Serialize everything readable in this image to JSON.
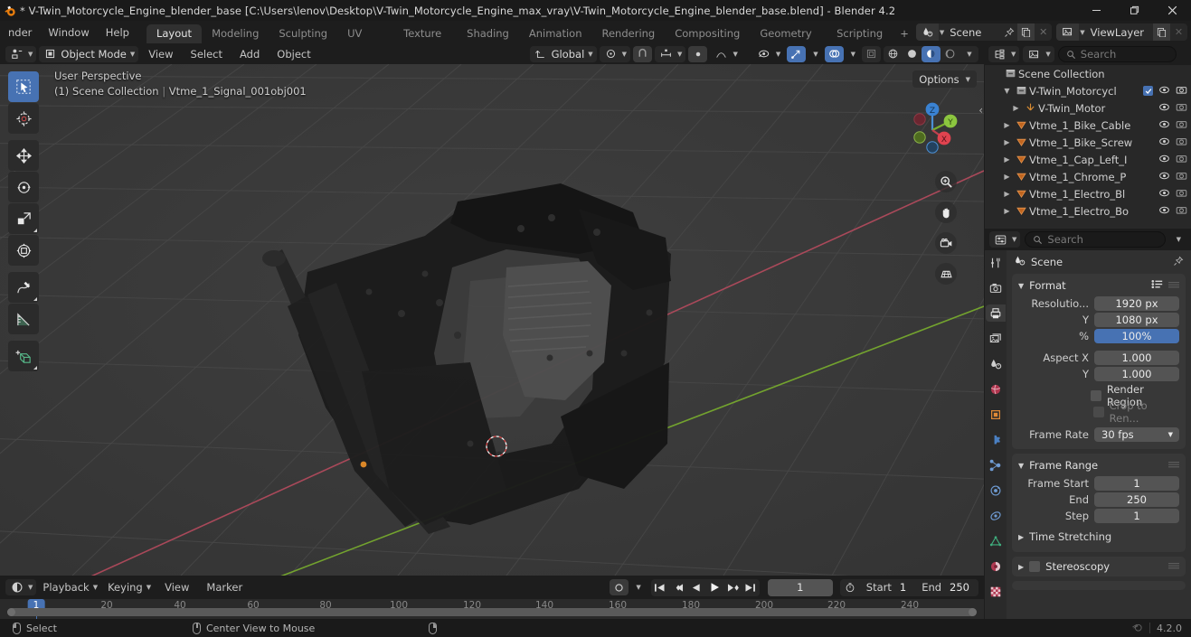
{
  "titlebar": {
    "title": "* V-Twin_Motorcycle_Engine_blender_base [C:\\Users\\lenov\\Desktop\\V-Twin_Motorcycle_Engine_max_vray\\V-Twin_Motorcycle_Engine_blender_base.blend] - Blender 4.2",
    "minimize": "—",
    "maximize": "❐",
    "close": "✕"
  },
  "menu": {
    "items": [
      "nder",
      "Window",
      "Help"
    ]
  },
  "workspaces": {
    "tabs": [
      {
        "label": "Layout",
        "active": true
      },
      {
        "label": "Modeling",
        "active": false
      },
      {
        "label": "Sculpting",
        "active": false
      },
      {
        "label": "UV Editing",
        "active": false
      },
      {
        "label": "Texture Paint",
        "active": false
      },
      {
        "label": "Shading",
        "active": false
      },
      {
        "label": "Animation",
        "active": false
      },
      {
        "label": "Rendering",
        "active": false
      },
      {
        "label": "Compositing",
        "active": false
      },
      {
        "label": "Geometry Nodes",
        "active": false
      },
      {
        "label": "Scripting",
        "active": false
      }
    ],
    "add": "+"
  },
  "scene_selector": {
    "scene": "Scene",
    "viewlayer": "ViewLayer"
  },
  "viewport_header": {
    "editor_type": "editor-type-3dview",
    "mode": "Object Mode",
    "menus": [
      "View",
      "Select",
      "Add",
      "Object"
    ],
    "transform_orientation": "Global",
    "snapping": "snap-magnet",
    "proportional": "proportional-editing"
  },
  "viewport": {
    "perspective": "User Perspective",
    "breadcrumb": "(1) Scene Collection",
    "active_object": "Vtme_1_Signal_001obj001",
    "separator": "|",
    "options_label": "Options",
    "gizmo_axes": [
      "Z",
      "Y",
      "X"
    ],
    "background_color": "#393939",
    "grid_color": "#4b4b4b",
    "axis_x_color": "#b94a5a",
    "axis_y_color": "#7aaf2e",
    "tools": [
      {
        "name": "tweak-tool",
        "active": true
      },
      {
        "name": "cursor-tool",
        "active": false
      },
      {
        "name": "move-tool",
        "active": false
      },
      {
        "name": "rotate-tool",
        "active": false
      },
      {
        "name": "scale-tool",
        "active": false
      },
      {
        "name": "transform-tool",
        "active": false
      },
      {
        "name": "annotate-tool",
        "active": false
      },
      {
        "name": "measure-tool",
        "active": false
      },
      {
        "name": "add-cube-tool",
        "active": false
      }
    ],
    "side_buttons": [
      "zoom-icon",
      "hand-icon",
      "camera-icon",
      "grid-icon"
    ]
  },
  "outliner": {
    "display_mode": "view-layer",
    "filter_icon": "filter-icon",
    "search_placeholder": "Search",
    "rows": [
      {
        "label": "Scene Collection",
        "icon": "collection-icon",
        "indent": 0,
        "disclosure": "",
        "checkbox": false,
        "eye": false,
        "camera": false
      },
      {
        "label": "V-Twin_Motorcycl",
        "icon": "collection-icon",
        "indent": 1,
        "disclosure": "open",
        "checkbox": true,
        "eye": true,
        "camera": true
      },
      {
        "label": "V-Twin_Motor",
        "icon": "empty-icon",
        "indent": 2,
        "disclosure": "closed",
        "checkbox": false,
        "eye": true,
        "camera": true
      },
      {
        "label": "Vtme_1_Bike_Cable",
        "icon": "mesh-icon",
        "indent": 1,
        "disclosure": "closed",
        "checkbox": false,
        "eye": true,
        "camera": true
      },
      {
        "label": "Vtme_1_Bike_Screw",
        "icon": "mesh-icon",
        "indent": 1,
        "disclosure": "closed",
        "checkbox": false,
        "eye": true,
        "camera": true
      },
      {
        "label": "Vtme_1_Cap_Left_I",
        "icon": "mesh-icon",
        "indent": 1,
        "disclosure": "closed",
        "checkbox": false,
        "eye": true,
        "camera": true
      },
      {
        "label": "Vtme_1_Chrome_P",
        "icon": "mesh-icon",
        "indent": 1,
        "disclosure": "closed",
        "checkbox": false,
        "eye": true,
        "camera": true
      },
      {
        "label": "Vtme_1_Electro_Bl",
        "icon": "mesh-icon",
        "indent": 1,
        "disclosure": "closed",
        "checkbox": false,
        "eye": true,
        "camera": true
      },
      {
        "label": "Vtme_1_Electro_Bo",
        "icon": "mesh-icon",
        "indent": 1,
        "disclosure": "closed",
        "checkbox": false,
        "eye": true,
        "camera": true
      }
    ]
  },
  "properties": {
    "search_placeholder": "Search",
    "breadcrumb": "Scene",
    "tabs": [
      {
        "name": "tool-tab",
        "active": false
      },
      {
        "name": "render-tab",
        "active": false
      },
      {
        "name": "output-tab",
        "active": true
      },
      {
        "name": "viewlayer-tab",
        "active": false
      },
      {
        "name": "scene-tab",
        "active": false
      },
      {
        "name": "world-tab",
        "active": false
      },
      {
        "name": "object-tab",
        "active": false
      },
      {
        "name": "modifiers-tab",
        "active": false
      },
      {
        "name": "particles-tab",
        "active": false
      },
      {
        "name": "physics-tab",
        "active": false
      },
      {
        "name": "constraints-tab",
        "active": false
      },
      {
        "name": "data-tab",
        "active": false
      },
      {
        "name": "material-tab",
        "active": false
      },
      {
        "name": "texture-tab",
        "active": false
      }
    ],
    "format_panel": {
      "title": "Format",
      "rows": [
        {
          "label": "Resolutio...",
          "value": "1920 px",
          "highlight": false
        },
        {
          "label": "Y",
          "value": "1080 px",
          "highlight": false
        },
        {
          "label": "%",
          "value": "100%",
          "highlight": true
        },
        {
          "label": "Aspect X",
          "value": "1.000",
          "highlight": false
        },
        {
          "label": "Y",
          "value": "1.000",
          "highlight": false
        }
      ],
      "checkboxes": [
        {
          "label": "Render Region",
          "checked": false,
          "dim": false
        },
        {
          "label": "Crop to Ren...",
          "checked": false,
          "dim": true
        }
      ],
      "frame_rate_label": "Frame Rate",
      "frame_rate_value": "30 fps"
    },
    "frame_range_panel": {
      "title": "Frame Range",
      "rows": [
        {
          "label": "Frame Start",
          "value": "1"
        },
        {
          "label": "End",
          "value": "250"
        },
        {
          "label": "Step",
          "value": "1"
        }
      ],
      "subpanel": "Time Stretching"
    },
    "stereoscopy_panel": {
      "title": "Stereoscopy",
      "checked": false
    }
  },
  "timeline": {
    "editor_icon": "timeline-icon",
    "menus": [
      "Playback",
      "Keying",
      "View",
      "Marker"
    ],
    "record_icon": "record-icon",
    "transport": [
      "jump-start",
      "prev-keyframe",
      "play-reverse",
      "play",
      "next-keyframe",
      "jump-end"
    ],
    "current_frame": "1",
    "start_label": "Start",
    "start_value": "1",
    "end_label": "End",
    "end_value": "250",
    "playhead_frame": "1",
    "ruler_ticks": [
      "20",
      "40",
      "60",
      "80",
      "100",
      "120",
      "140",
      "160",
      "180",
      "200",
      "220",
      "240"
    ]
  },
  "statusbar": {
    "items": [
      {
        "icon": "mouse-left",
        "label": "Select"
      },
      {
        "icon": "mouse-middle",
        "label": "Center View to Mouse"
      },
      {
        "icon": "mouse-right",
        "label": ""
      }
    ],
    "version": "4.2.0",
    "scene_stats_icon": "blender-icon"
  }
}
